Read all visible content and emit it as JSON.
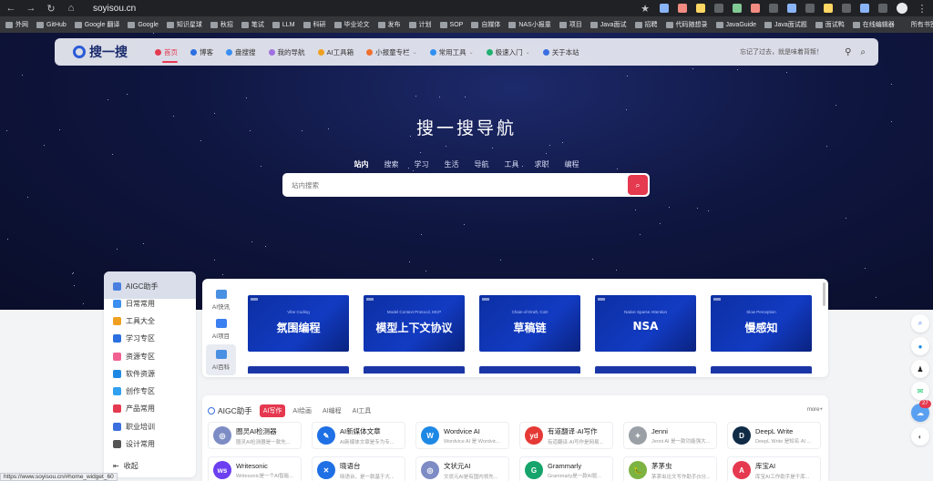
{
  "browser": {
    "url": "soyisou.cn",
    "bookmarks": [
      "外网",
      "GitHub",
      "Google 翻译",
      "Google",
      "知识星球",
      "秋招",
      "笔试",
      "LLM",
      "科研",
      "毕业论文",
      "发布",
      "计划",
      "SOP",
      "自媒体",
      "NAS小报童",
      "项目",
      "Java面试",
      "招聘",
      "代码随想录",
      "JavaGuide",
      "Java面试题",
      "面试鸭",
      "在线编辑器"
    ],
    "all_bookmarks": "所有书签",
    "status_url": "https://www.soyisou.cn/#home_widget_60"
  },
  "header": {
    "logo_text": "搜一搜",
    "nav": [
      {
        "label": "首页",
        "color": "#e53950"
      },
      {
        "label": "博客",
        "color": "#2b6fe0"
      },
      {
        "label": "盘搜搜",
        "color": "#3b8ff0"
      },
      {
        "label": "我的导航",
        "color": "#a070e0"
      },
      {
        "label": "AI工具箱",
        "color": "#f0a020"
      },
      {
        "label": "小报童专栏",
        "color": "#f07030"
      },
      {
        "label": "常用工具",
        "color": "#3090f0"
      },
      {
        "label": "极速入门",
        "color": "#20b070"
      },
      {
        "label": "关于本站",
        "color": "#3b6fe0"
      }
    ],
    "slogan": "忘记了过去，就是味着背叛！"
  },
  "hero": {
    "title": "搜一搜导航",
    "tabs": [
      "站内",
      "搜索",
      "学习",
      "生活",
      "导航",
      "工具",
      "求职",
      "编程"
    ],
    "search_placeholder": "站内搜索"
  },
  "sidebar": {
    "items": [
      {
        "label": "AIGC助手",
        "color": "#4a7fe0"
      },
      {
        "label": "日常常用",
        "color": "#3b8ff0"
      },
      {
        "label": "工具大全",
        "color": "#f0a020"
      },
      {
        "label": "学习专区",
        "color": "#2b6fe0"
      },
      {
        "label": "资源专区",
        "color": "#f06090"
      },
      {
        "label": "软件资源",
        "color": "#1e88e5"
      },
      {
        "label": "创作专区",
        "color": "#30a0f0"
      },
      {
        "label": "产品常用",
        "color": "#e53950"
      },
      {
        "label": "职业培训",
        "color": "#3b6fe0"
      },
      {
        "label": "设计常用",
        "color": "#555555"
      }
    ],
    "collapse_label": "收起"
  },
  "carousel": {
    "tabs": [
      {
        "label": "AI快讯",
        "color": "#4a90e2"
      },
      {
        "label": "AI项目",
        "color": "#3b7ff0"
      },
      {
        "label": "AI百科",
        "color": "#4a90e2"
      }
    ],
    "slides": [
      {
        "small": "Vibe Coding",
        "big": "氛围编程"
      },
      {
        "small": "Model Context Protocol, MCP",
        "big": "模型上下文协议"
      },
      {
        "small": "Chain-of-Draft, CoD",
        "big": "草稿链"
      },
      {
        "small": "Native Sparse Attention",
        "big": "NSA"
      },
      {
        "small": "Slow Perception",
        "big": "慢感知"
      }
    ]
  },
  "aigc": {
    "title": "AIGC助手",
    "tabs": [
      "AI写作",
      "AI绘画",
      "AI编程",
      "AI工具"
    ],
    "more": "more+",
    "tools": [
      {
        "name": "圈灵AI检测器",
        "desc": "圈灵AI检测器是一款先...",
        "color": "#7d8cc4",
        "glyph": "◎"
      },
      {
        "name": "AI新媒体文章",
        "desc": "AI新媒体文章是专为专...",
        "color": "#1f6fe5",
        "glyph": "✎"
      },
      {
        "name": "Wordvice AI",
        "desc": "Wordvice AI 是 Wordvic...",
        "color": "#1e88e5",
        "glyph": "W"
      },
      {
        "name": "有道翻译·AI写作",
        "desc": "有道翻译·AI写作是网易...",
        "color": "#e53935",
        "glyph": "yd"
      },
      {
        "name": "Jenni",
        "desc": "Jenni AI 是一款功能强大...",
        "color": "#9aa0a6",
        "glyph": "✦"
      },
      {
        "name": "DeepL Write",
        "desc": "DeepL Write 是知名 AI ...",
        "color": "#0f2b46",
        "glyph": "D"
      },
      {
        "name": "Writesonic",
        "desc": "Writesonic是一个AI智能...",
        "color": "#6c3ff0",
        "glyph": "ws"
      },
      {
        "name": "晓语台",
        "desc": "晓语台，是一款基于大...",
        "color": "#1f6fe5",
        "glyph": "✕"
      },
      {
        "name": "文状元AI",
        "desc": "文状元AI是有国内领先...",
        "color": "#7d8cc4",
        "glyph": "◎"
      },
      {
        "name": "Grammarly",
        "desc": "Grammarly是一款AI驱...",
        "color": "#15a46b",
        "glyph": "G"
      },
      {
        "name": "茅茅虫",
        "desc": "茅茅虫论文写作助手(5分...",
        "color": "#7cb342",
        "glyph": "🐛"
      },
      {
        "name": "库宝AI",
        "desc": "库宝AI工作助手是千库...",
        "color": "#e53950",
        "glyph": "A"
      }
    ]
  },
  "float": {
    "badge": "27"
  }
}
